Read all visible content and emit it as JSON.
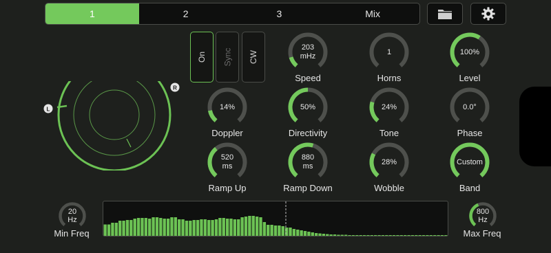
{
  "tabs": [
    {
      "label": "1",
      "active": true
    },
    {
      "label": "2",
      "active": false
    },
    {
      "label": "3",
      "active": false
    },
    {
      "label": "Mix",
      "active": false
    }
  ],
  "toolbar": {
    "folder_icon": "folder-icon",
    "settings_icon": "gear-icon"
  },
  "toggles": [
    {
      "label": "On",
      "active": true
    },
    {
      "label": "Sync",
      "active": false
    },
    {
      "label": "CW",
      "active": false
    }
  ],
  "speaker_field": {
    "left_label": "L",
    "right_label": "R"
  },
  "knobs": [
    {
      "label": "Speed",
      "value": "203",
      "unit": "mHz",
      "fill": 0.12
    },
    {
      "label": "Horns",
      "value": "1",
      "unit": "",
      "fill": 0.0
    },
    {
      "label": "Level",
      "value": "100%",
      "unit": "",
      "fill": 0.62
    },
    {
      "label": "Doppler",
      "value": "14%",
      "unit": "",
      "fill": 0.14
    },
    {
      "label": "Directivity",
      "value": "50%",
      "unit": "",
      "fill": 0.5
    },
    {
      "label": "Tone",
      "value": "24%",
      "unit": "",
      "fill": 0.24
    },
    {
      "label": "Phase",
      "value": "0.0°",
      "unit": "",
      "fill": 0.0
    },
    {
      "label": "Ramp Up",
      "value": "520",
      "unit": "ms",
      "fill": 0.36
    },
    {
      "label": "Ramp Down",
      "value": "880",
      "unit": "ms",
      "fill": 0.56
    },
    {
      "label": "Wobble",
      "value": "28%",
      "unit": "",
      "fill": 0.28
    },
    {
      "label": "Band",
      "value": "Custom",
      "unit": "",
      "fill": 1.0
    }
  ],
  "min_freq": {
    "label": "Min Freq",
    "value": "20",
    "unit": "Hz",
    "fill": 0.0
  },
  "max_freq": {
    "label": "Max Freq",
    "value": "800",
    "unit": "Hz",
    "fill": 0.42
  },
  "spectrum": {
    "levels": [
      0.33,
      0.33,
      0.38,
      0.38,
      0.44,
      0.44,
      0.46,
      0.46,
      0.5,
      0.52,
      0.52,
      0.52,
      0.5,
      0.54,
      0.54,
      0.52,
      0.5,
      0.5,
      0.54,
      0.54,
      0.48,
      0.48,
      0.44,
      0.44,
      0.46,
      0.46,
      0.48,
      0.48,
      0.46,
      0.46,
      0.48,
      0.52,
      0.52,
      0.5,
      0.5,
      0.48,
      0.48,
      0.54,
      0.56,
      0.58,
      0.58,
      0.56,
      0.54,
      0.4,
      0.32,
      0.32,
      0.3,
      0.3,
      0.28,
      0.24,
      0.24,
      0.2,
      0.18,
      0.16,
      0.14,
      0.12,
      0.1,
      0.08,
      0.07,
      0.06,
      0.05,
      0.04,
      0.04,
      0.03,
      0.03,
      0.03,
      0.02,
      0.02,
      0.02,
      0.02,
      0.02,
      0.02,
      0.02,
      0.02,
      0.02,
      0.02,
      0.02,
      0.02,
      0.02,
      0.02,
      0.02,
      0.02,
      0.02,
      0.02,
      0.02,
      0.02,
      0.02,
      0.02,
      0.02,
      0.02,
      0.02,
      0.02,
      0.02
    ],
    "marker_fraction": 0.53,
    "bar_color": "#6cc254"
  },
  "colors": {
    "accent": "#74c95c",
    "track": "#4e504c"
  }
}
